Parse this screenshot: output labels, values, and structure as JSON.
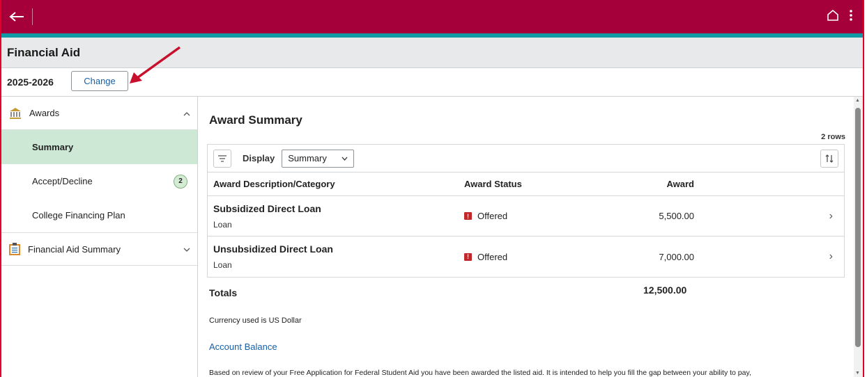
{
  "header": {
    "page_title": "Financial Aid",
    "aid_year": "2025-2026",
    "change_label": "Change"
  },
  "sidebar": {
    "groups": [
      {
        "label": "Awards",
        "icon": "bank-icon",
        "expanded": true
      },
      {
        "label": "Financial Aid Summary",
        "icon": "clipboard-icon",
        "expanded": false
      }
    ],
    "items": [
      {
        "label": "Summary",
        "active": true
      },
      {
        "label": "Accept/Decline",
        "badge": "2"
      },
      {
        "label": "College Financing Plan"
      }
    ]
  },
  "main": {
    "section_title": "Award Summary",
    "rows_count": "2 rows",
    "display_label": "Display",
    "display_value": "Summary",
    "columns": [
      "Award Description/Category",
      "Award Status",
      "Award"
    ],
    "rows": [
      {
        "description": "Subsidized Direct Loan",
        "category": "Loan",
        "status": "Offered",
        "award": "5,500.00"
      },
      {
        "description": "Unsubsidized Direct Loan",
        "category": "Loan",
        "status": "Offered",
        "award": "7,000.00"
      }
    ],
    "totals_label": "Totals",
    "totals_value": "12,500.00",
    "currency_note": "Currency used is US Dollar",
    "account_balance_link": "Account Balance",
    "disclaimer": "Based on review of your Free Application for Federal Student Aid you have been awarded the listed aid. It is intended to help you fill the gap between your ability to pay,"
  },
  "colors": {
    "topbar": "#a5003a",
    "accent_bar": "#109aa3",
    "active_item": "#cde9d6",
    "link": "#1660a8",
    "status_warning": "#c0282c",
    "annotation_arrow": "#c8102e"
  }
}
